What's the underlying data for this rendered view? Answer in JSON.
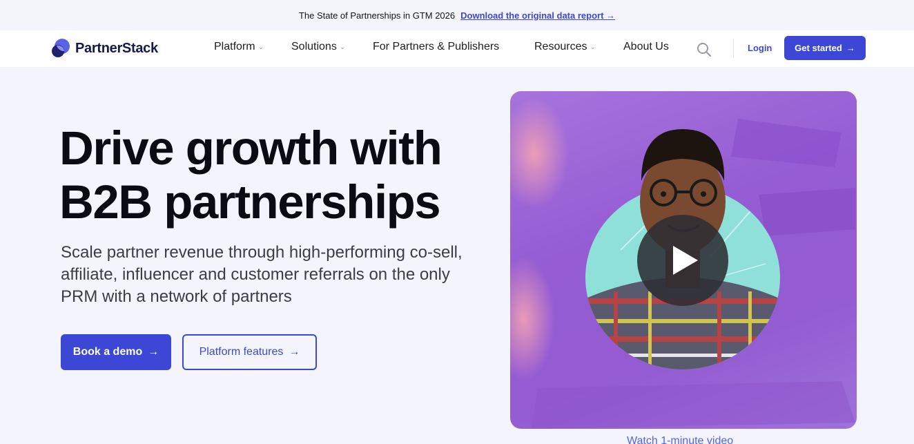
{
  "announcement": {
    "text": "The State of Partnerships in GTM 2026",
    "link": "Download the original data report →"
  },
  "brand": {
    "name": "PartnerStack"
  },
  "nav": {
    "items": [
      {
        "label": "Platform",
        "has_dropdown": true
      },
      {
        "label": "Solutions",
        "has_dropdown": true
      },
      {
        "label": "For Partners & Publishers",
        "has_dropdown": false
      },
      {
        "label": "Resources",
        "has_dropdown": true
      },
      {
        "label": "About Us",
        "has_dropdown": false
      }
    ],
    "login": "Login",
    "get_started": "Get started",
    "icons": {
      "search": "search-icon",
      "dropdown": "chevron-down-icon",
      "arrow": "arrow-right-icon"
    }
  },
  "hero": {
    "title_line1": "Drive growth with",
    "title_line2": "B2B partnerships",
    "sub_line1": "Scale partner revenue through high-performing co-sell,",
    "sub_line2": "affiliate, influencer and customer referrals on the only",
    "sub_line3": "PRM with a network of partners",
    "cta_primary": "Book a demo",
    "cta_secondary": "Platform features",
    "arrow": "→"
  },
  "video": {
    "caption": "Watch 1-minute video",
    "icon": "play-icon"
  },
  "colors": {
    "accent": "#3d47d6",
    "page_bg": "#f4f4fd",
    "video_bg": "#9158d1",
    "portrait_bg": "#8ee0d8"
  }
}
